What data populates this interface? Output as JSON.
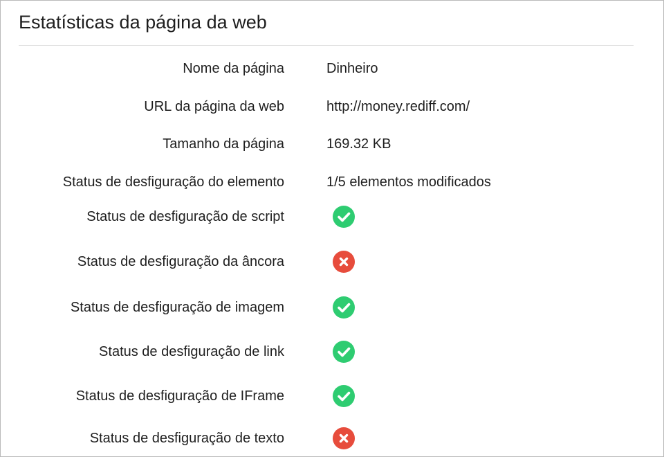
{
  "panel": {
    "title": "Estatísticas da página da web"
  },
  "info_rows": [
    {
      "label": "Nome da página",
      "value": "Dinheiro"
    },
    {
      "label": "URL da página da web",
      "value": "http://money.rediff.com/"
    },
    {
      "label": "Tamanho da página",
      "value": "169.32 KB"
    },
    {
      "label": "Status de desfiguração do elemento",
      "value": "1/5 elementos modificados"
    }
  ],
  "status_rows": [
    {
      "label": "Status de desfiguração de script",
      "status": "ok",
      "icon": "check-circle-icon"
    },
    {
      "label": "Status de desfiguração da âncora",
      "status": "defaced",
      "icon": "x-circle-icon"
    },
    {
      "label": "Status de desfiguração de imagem",
      "status": "ok",
      "icon": "check-circle-icon"
    },
    {
      "label": "Status de desfiguração de link",
      "status": "ok",
      "icon": "check-circle-icon"
    },
    {
      "label": "Status de desfiguração de IFrame",
      "status": "ok",
      "icon": "check-circle-icon"
    },
    {
      "label": "Status de desfiguração de texto",
      "status": "defaced",
      "icon": "x-circle-icon"
    }
  ],
  "colors": {
    "ok": "#2ecc71",
    "defaced": "#e74c3c"
  }
}
